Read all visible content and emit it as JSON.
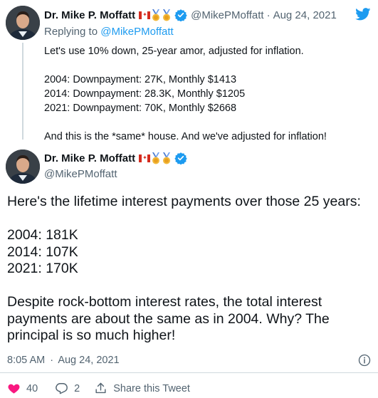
{
  "reply_tweet": {
    "author_name": "Dr. Mike P. Moffatt",
    "handle": "@MikePMoffatt",
    "date": "Aug 24, 2021",
    "separator": "·",
    "replying_prefix": "Replying to",
    "replying_to": "@MikePMoffatt",
    "lines": [
      "Let's use 10% down, 25-year amor, adjusted for inflation.",
      "",
      "2004: Downpayment: 27K, Monthly $1413",
      "2014: Downpayment: 28.3K, Monthly $1205",
      "2021: Downpayment: 70K, Monthly $2668",
      "",
      "And this is the *same* house. And we've adjusted for inflation!"
    ]
  },
  "main_tweet": {
    "author_name": "Dr. Mike P. Moffatt",
    "handle": "@MikePMoffatt",
    "intro": "Here's the lifetime interest payments over those 25 years:",
    "figures": [
      "2004: 181K",
      "2014: 107K",
      "2021: 170K"
    ],
    "conclusion": "Despite rock-bottom interest rates, the total interest payments are about the same as in 2004. Why? The principal is so much higher!",
    "time": "8:05 AM",
    "separator": "·",
    "date": "Aug 24, 2021"
  },
  "actions": {
    "like_count": "40",
    "reply_count": "2",
    "share_label": "Share this Tweet"
  },
  "icons": [
    "canada-flag-icon",
    "medal-icon",
    "verified-icon",
    "twitter-bird-icon",
    "info-icon",
    "heart-icon",
    "reply-icon",
    "share-icon"
  ],
  "colors": {
    "accent": "#1d9bf0",
    "muted": "#536471",
    "text": "#0f1419",
    "like": "#f91880"
  }
}
